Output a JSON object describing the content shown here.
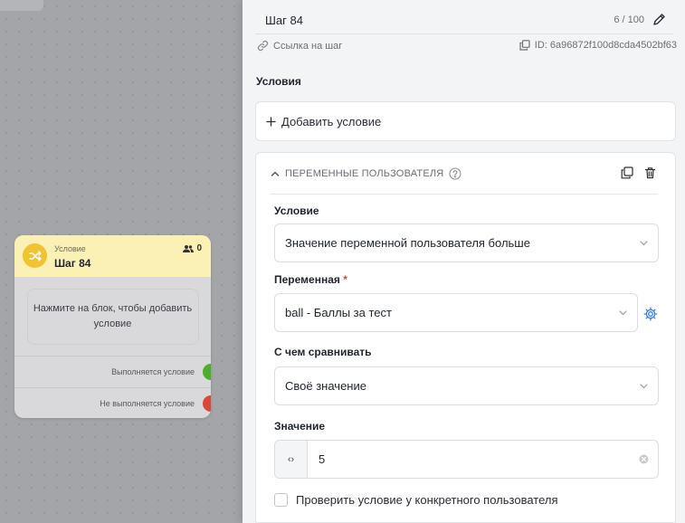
{
  "node": {
    "type": "Условие",
    "title": "Шаг 84",
    "users_count": "0",
    "hint": "Нажмите на блок, чтобы добавить условие",
    "outputs": [
      {
        "label": "Выполняется условие",
        "color": "#4caf2a"
      },
      {
        "label": "Не выполняется условие",
        "color": "#d9483b"
      }
    ]
  },
  "panel": {
    "step_name": "Шаг 84",
    "char_count": "6 / 100",
    "link_label": "Ссылка на шаг",
    "step_id": "ID: 6a96872f100d8cda4502bf63",
    "section_title": "Условия",
    "add_condition": "Добавить условие",
    "card": {
      "title": "ПЕРЕМЕННЫЕ ПОЛЬЗОВАТЕЛЯ",
      "condition_label": "Условие",
      "condition_value": "Значение переменной пользователя больше",
      "variable_label": "Переменная",
      "variable_required": "*",
      "variable_value": "ball - Баллы за тест",
      "compare_label": "С чем сравнивать",
      "compare_value": "Своё значение",
      "value_label": "Значение",
      "value_prefix": "‹›",
      "value": "5",
      "checkbox_label": "Проверить условие у конкретного пользователя"
    }
  },
  "colors": {
    "node_header": "#fbf1b4",
    "node_icon": "#f2c230",
    "accent": "#3d7be0"
  },
  "icons": [
    "shuffle-icon",
    "users-icon",
    "pencil-icon",
    "link-icon",
    "copy-icon",
    "plus-icon",
    "chevron-up-icon",
    "help-icon",
    "trash-icon",
    "chevron-down-icon",
    "gear-icon",
    "clear-icon"
  ]
}
